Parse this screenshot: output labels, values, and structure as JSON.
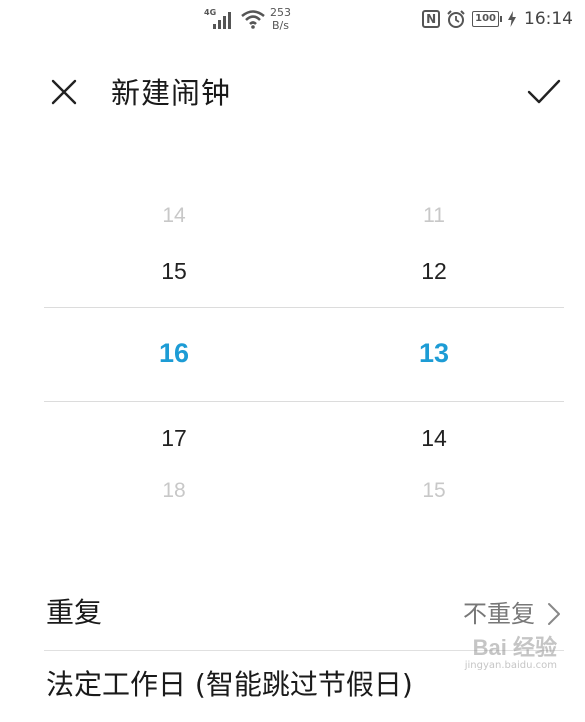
{
  "status_bar": {
    "network_generation": "4G",
    "net_speed_value": "253",
    "net_speed_unit": "B/s",
    "nfc_glyph": "N",
    "battery_level": "100",
    "time": "16:14",
    "icons": [
      "signal-icon",
      "wifi-icon",
      "nfc-icon",
      "alarm-icon",
      "battery-icon",
      "charging-icon"
    ]
  },
  "header": {
    "title": "新建闹钟",
    "close_icon": "close-icon",
    "confirm_icon": "check-icon"
  },
  "time_picker": {
    "accent_color": "#1d9cd5",
    "hours": {
      "above_far": "14",
      "above": "15",
      "selected": "16",
      "below": "17",
      "below_far": "18"
    },
    "minutes": {
      "above_far": "11",
      "above": "12",
      "selected": "13",
      "below": "14",
      "below_far": "15"
    }
  },
  "settings": {
    "repeat": {
      "label": "重复",
      "value": "不重复"
    },
    "holiday": {
      "label": "法定工作日 (智能跳过节假日)"
    }
  },
  "watermark": {
    "main": "Bai 经验",
    "sub": "jingyan.baidu.com"
  }
}
